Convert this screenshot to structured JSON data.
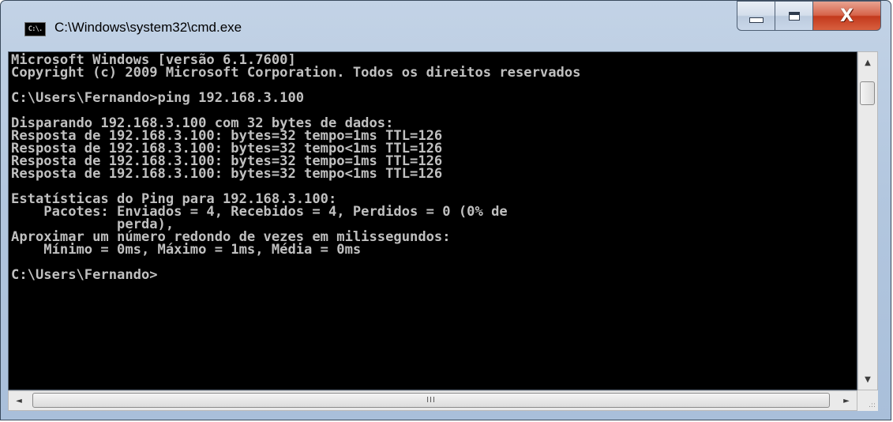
{
  "window": {
    "title": "C:\\Windows\\system32\\cmd.exe",
    "icon_text": "C:\\."
  },
  "caption_buttons": {
    "minimize_icon": "minimize-icon",
    "maximize_icon": "maximize-icon",
    "close_icon": "close-icon",
    "close_glyph": "X"
  },
  "console": {
    "lines": [
      "Microsoft Windows [versão 6.1.7600]",
      "Copyright (c) 2009 Microsoft Corporation. Todos os direitos reservados",
      "",
      "C:\\Users\\Fernando>ping 192.168.3.100",
      "",
      "Disparando 192.168.3.100 com 32 bytes de dados:",
      "Resposta de 192.168.3.100: bytes=32 tempo=1ms TTL=126",
      "Resposta de 192.168.3.100: bytes=32 tempo<1ms TTL=126",
      "Resposta de 192.168.3.100: bytes=32 tempo=1ms TTL=126",
      "Resposta de 192.168.3.100: bytes=32 tempo<1ms TTL=126",
      "",
      "Estatísticas do Ping para 192.168.3.100:",
      "    Pacotes: Enviados = 4, Recebidos = 4, Perdidos = 0 (0% de",
      "             perda),",
      "Aproximar um número redondo de vezes em milissegundos:",
      "    Mínimo = 0ms, Máximo = 1ms, Média = 0ms",
      "",
      "C:\\Users\\Fernando>"
    ],
    "text_color": "#c0c0c0",
    "background": "#000000"
  },
  "scrollbars": {
    "up_arrow": "▲",
    "down_arrow": "▼",
    "left_arrow": "◄",
    "right_arrow": "►",
    "h_thumb_grip": "III",
    "resize_grip": ".::"
  }
}
